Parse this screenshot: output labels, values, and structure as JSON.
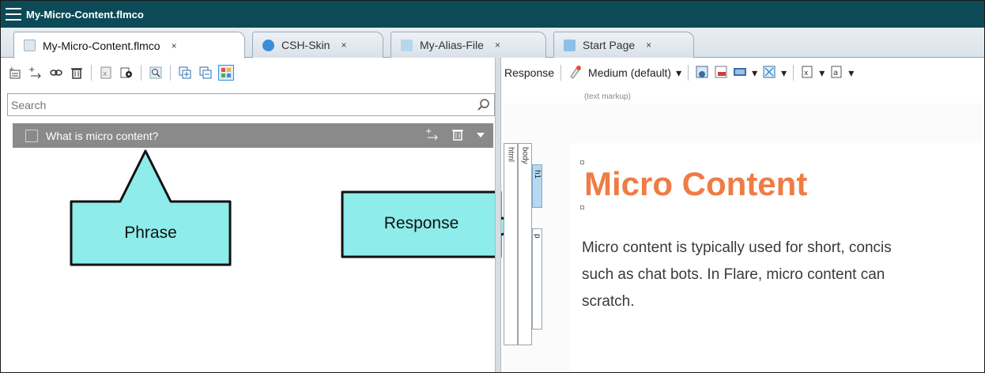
{
  "window": {
    "title": "My-Micro-Content.flmco"
  },
  "tabs": [
    {
      "label": "My-Micro-Content.flmco",
      "close": "×",
      "active": true,
      "icon": "document-icon",
      "icon_color": "#9fb4c4"
    },
    {
      "label": "CSH-Skin",
      "close": "×",
      "active": false,
      "icon": "skin-icon",
      "icon_color": "#3a8ed8"
    },
    {
      "label": "My-Alias-File",
      "close": "×",
      "active": false,
      "icon": "alias-file-icon",
      "icon_color": "#6fb2e0"
    },
    {
      "label": "Start Page",
      "close": "×",
      "active": false,
      "icon": "start-page-icon",
      "icon_color": "#4c9ad6"
    }
  ],
  "left_toolbar": {
    "icons": [
      "add-phrase-icon",
      "add-response-icon",
      "link-icon",
      "delete-icon",
      "export-icon",
      "preview-icon",
      "find-icon",
      "expand-all-icon",
      "collapse-all-icon",
      "grid-view-icon"
    ]
  },
  "search": {
    "placeholder": "Search",
    "value": ""
  },
  "phrase": {
    "label": "What is micro content?"
  },
  "right_toolbar": {
    "response_label": "Response",
    "style_label": "Medium (default)",
    "dropdown_glyph": "▾"
  },
  "editor": {
    "markup_hint": "(text markup)",
    "structure": {
      "html": "html",
      "body": "body",
      "h1": "h1",
      "p": "p"
    },
    "heading": "Micro Content",
    "paragraph_lines": [
      "Micro content is typically used for short, concis",
      "such as chat bots. In Flare, micro content can",
      "scratch."
    ]
  },
  "callouts": {
    "phrase": "Phrase",
    "response": "Response",
    "fill": "#8eecea",
    "stroke": "#111111"
  },
  "colors": {
    "titlebar": "#0d4a57",
    "heading": "#f07b45",
    "phrase_row": "#8a8a8a"
  }
}
